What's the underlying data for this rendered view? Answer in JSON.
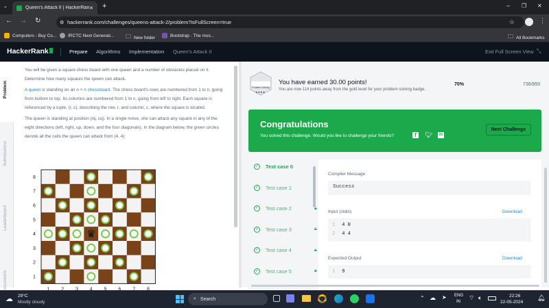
{
  "browser": {
    "tab_title": "Queen's Attack II | HackerRank",
    "url": "hackerrank.com/challenges/queens-attack-2/problem?isFullScreen=true",
    "bookmarks": [
      "Computers - Buy Co...",
      "IRCTC Next Generati...",
      "New folder",
      "Bootstrap · The mos..."
    ],
    "all_bookmarks": "All Bookmarks"
  },
  "header": {
    "logo": "HackerRank",
    "nav": [
      "Prepare",
      "Algorithms",
      "Implementation",
      "Queen's Attack II"
    ],
    "exit_full": "Exit Full Screen View"
  },
  "side_tabs": [
    "Problem",
    "Submissions",
    "Leaderboard",
    "Discussions"
  ],
  "problem": {
    "p1": "You will be given a square chess board with one queen and a number of obstacles placed on it. Determine how many squares the queen can attack.",
    "p2a": "A",
    "p2_link1": "queen",
    "p2b": "is standing on an n × n",
    "p2_link2": "chessboard",
    "p2c": ". The chess board's rows are numbered from 1 to n, going from bottom to top. Its columns are numbered from 1 to n, going from left to right. Each square is referenced by a tuple, (r, c), describing the row, r, and column, c, where the square is located.",
    "p3": "The queen is standing at position (rq, cq). In a single move, she can attack any square in any of the eight directions (left, right, up, down, and the four diagonals). In the diagram below, the green circles denote all the cells the queen can attack from (4, 4):",
    "board_ranks": [
      "8",
      "7",
      "6",
      "5",
      "4",
      "3",
      "2",
      "1"
    ],
    "board_files": [
      "1",
      "2",
      "3",
      "4",
      "5",
      "6",
      "7",
      "8"
    ]
  },
  "badge": {
    "label": "Problem Solving",
    "stars": "★★★★",
    "title": "You have earned 30.00 points!",
    "subtitle": "You are now 114 points away from the gold level for your problem solving badge.",
    "percent": "70%",
    "percent_value": 0.7,
    "score": "736/850"
  },
  "congrats": {
    "title": "Congratulations",
    "subtitle": "You solved this challenge. Would you like to challenge your friends?",
    "button": "Next Challenge"
  },
  "test_cases": [
    {
      "label": "Test case 0",
      "locked": false,
      "active": true
    },
    {
      "label": "Test case 1",
      "locked": false,
      "active": false
    },
    {
      "label": "Test case 2",
      "locked": true,
      "active": false
    },
    {
      "label": "Test case 3",
      "locked": true,
      "active": false
    },
    {
      "label": "Test case 4",
      "locked": true,
      "active": false
    },
    {
      "label": "Test case 5",
      "locked": true,
      "active": false
    }
  ],
  "result": {
    "compiler_label": "Compiler Message",
    "compiler_value": "Success",
    "input_label": "Input (stdin)",
    "download": "Download",
    "input_lines": [
      {
        "n": "1",
        "text": "4 0"
      },
      {
        "n": "2",
        "text": "4 4"
      }
    ],
    "expected_label": "Expected Output",
    "expected_lines": [
      {
        "n": "1",
        "text": "9"
      }
    ]
  },
  "taskbar": {
    "temp": "29°C",
    "weather": "Mostly cloudy",
    "search": "Search",
    "lang1": "ENG",
    "lang2": "IN",
    "time": "22:26",
    "date": "22-05-2024"
  },
  "colors": {
    "brand_green": "#1ba94c",
    "dark": "#0e141e",
    "board_dark": "#7a4218"
  }
}
